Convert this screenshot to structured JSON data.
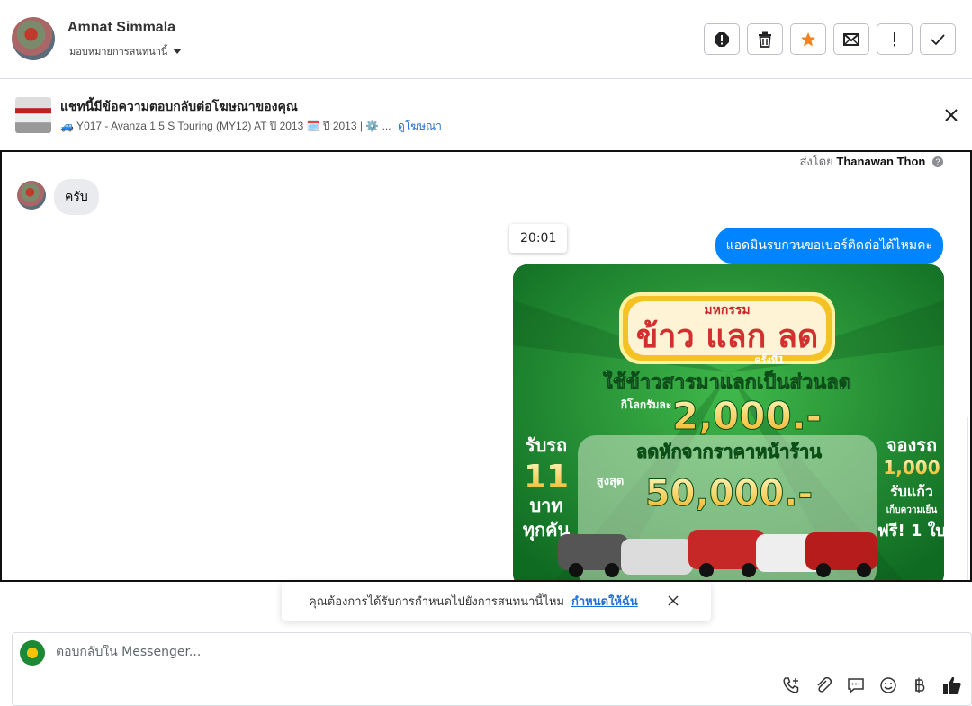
{
  "header": {
    "contact_name": "Amnat Simmala",
    "assign_label": "มอบหมายการสนทนานี้",
    "toolbar": [
      "spam-icon",
      "trash-icon",
      "star-icon",
      "mail-icon",
      "exclamation-icon",
      "check-icon"
    ],
    "star_color": "#f5821f"
  },
  "banner": {
    "title": "แชทนี้มีข้อความตอบกลับต่อโฆษณาของคุณ",
    "subtitle": "🚙 Y017 - Avanza 1.5 S Touring (MY12) AT ปี 2013 🗓️ ปี 2013 | ⚙️ ...",
    "link": "ดูโฆษณา"
  },
  "chat": {
    "sent_by_prefix": "ส่งโดย",
    "sent_by_name": "Thanawan Thon",
    "incoming_message": "ครับ",
    "timestamp": "20:01",
    "outgoing_message": "แอดมินรบกวนขอเบอร์ติดต่อได้ไหมคะ",
    "outgoing_color": "#0084ff",
    "ad_image": {
      "header_small": "มหกรรม",
      "header_big": "ข้าว แลก ลด",
      "round": "ครั้งที่1",
      "line1": "ใช้ข้าวสารมาแลกเป็นส่วนลด",
      "per_kg": "กิโลกรัมละ",
      "price": "2,000.-",
      "line2": "ลดหักจากราคาหน้าร้าน",
      "max_label": "สูงสุด",
      "max_value": "50,000.-",
      "left_1": "รับรถ",
      "left_2": "11",
      "left_3": "บาท",
      "left_4": "ทุกคัน",
      "right_1": "จองรถ",
      "right_2": "1,000",
      "right_3": "รับแก้ว",
      "right_4": "เก็บความเย็น",
      "right_5": "ฟรี! 1 ใบ"
    }
  },
  "notice": {
    "text": "คุณต้องการได้รับการกำหนดไปยังการสนทนานี้ไหม",
    "action": "กำหนดให้ฉัน"
  },
  "composer": {
    "placeholder": "ตอบกลับใน Messenger...",
    "icons": [
      "call-icon",
      "attach-icon",
      "saved-replies-icon",
      "emoji-icon",
      "baht-icon",
      "like-icon"
    ]
  }
}
